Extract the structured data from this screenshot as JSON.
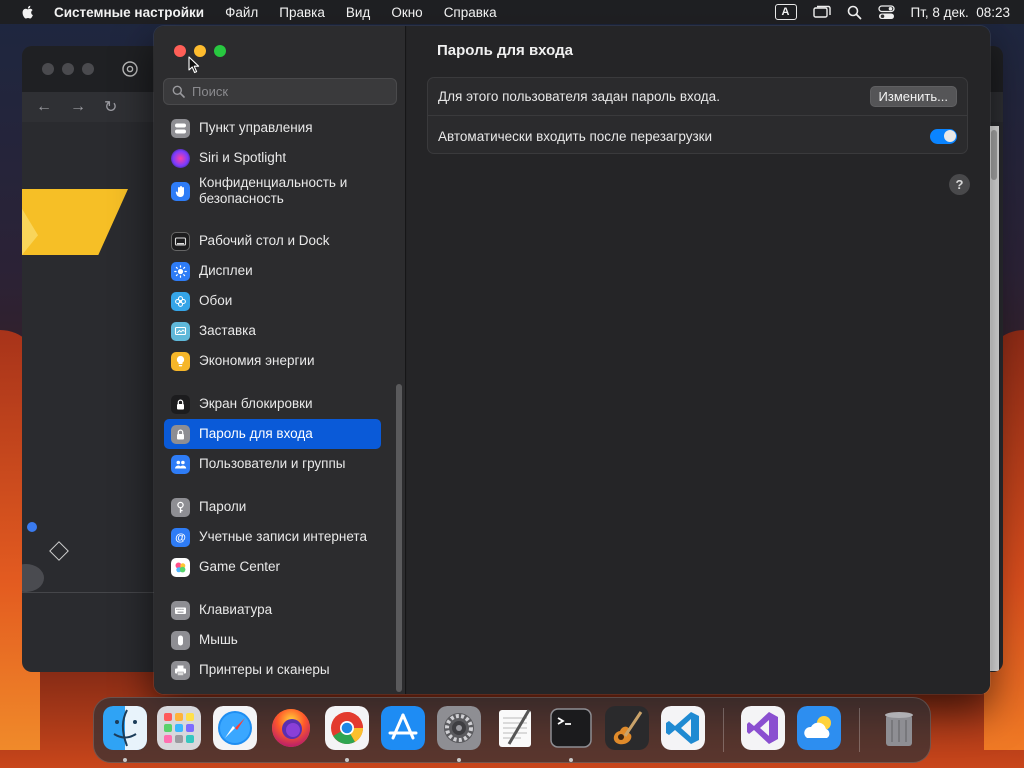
{
  "menubar": {
    "app_name": "Системные настройки",
    "items": [
      "Файл",
      "Правка",
      "Вид",
      "Окно",
      "Справка"
    ],
    "input_source": "A",
    "datetime": "Пт, 8 дек.  08:23"
  },
  "sidebar": {
    "search_placeholder": "Поиск",
    "items": [
      {
        "label": "Пункт управления",
        "icon": "control-center-icon",
        "color": "#8e8e93"
      },
      {
        "label": "Siri и Spotlight",
        "icon": "siri-icon",
        "color": "#b03cff"
      },
      {
        "label": "Конфиденциальность и безопасность",
        "icon": "hand-icon",
        "color": "#2e7cf6"
      },
      {
        "label": "Рабочий стол и Dock",
        "icon": "dock-icon",
        "color": "#1c1c1e"
      },
      {
        "label": "Дисплеи",
        "icon": "sun-icon",
        "color": "#2e7cf6"
      },
      {
        "label": "Обои",
        "icon": "flower-icon",
        "color": "#35a5e8"
      },
      {
        "label": "Заставка",
        "icon": "screensaver-icon",
        "color": "#5fb8d9"
      },
      {
        "label": "Экономия энергии",
        "icon": "bulb-icon",
        "color": "#f6b629"
      },
      {
        "label": "Экран блокировки",
        "icon": "lock-screen-icon",
        "color": "#1c1c1e"
      },
      {
        "label": "Пароль для входа",
        "icon": "lock-icon",
        "color": "#8e8e93",
        "active": true
      },
      {
        "label": "Пользователи и группы",
        "icon": "users-icon",
        "color": "#2e7cf6"
      },
      {
        "label": "Пароли",
        "icon": "key-icon",
        "color": "#8e8e93"
      },
      {
        "label": "Учетные записи интернета",
        "icon": "at-icon",
        "color": "#2e7cf6"
      },
      {
        "label": "Game Center",
        "icon": "game-center-icon",
        "color": "#ffffff"
      },
      {
        "label": "Клавиатура",
        "icon": "keyboard-icon",
        "color": "#8e8e93"
      },
      {
        "label": "Мышь",
        "icon": "mouse-icon",
        "color": "#8e8e93"
      },
      {
        "label": "Принтеры и сканеры",
        "icon": "printer-icon",
        "color": "#8e8e93"
      }
    ]
  },
  "content": {
    "title": "Пароль для входа",
    "password_row": {
      "label": "Для этого пользователя задан пароль входа.",
      "button": "Изменить..."
    },
    "autologin_row": {
      "label": "Автоматически входить после перезагрузки",
      "enabled": true
    },
    "help": "?"
  },
  "colors": {
    "accent": "#0a5ad8",
    "toggle_on": "#0a84ff"
  },
  "dock": {
    "apps": [
      "finder-icon",
      "launchpad-icon",
      "safari-icon",
      "firefox-icon",
      "chrome-icon",
      "app-store-icon",
      "system-settings-icon",
      "textedit-icon",
      "terminal-icon",
      "garageband-icon",
      "vscode-icon",
      "visual-studio-icon",
      "weather-icon",
      "trash-icon"
    ]
  }
}
